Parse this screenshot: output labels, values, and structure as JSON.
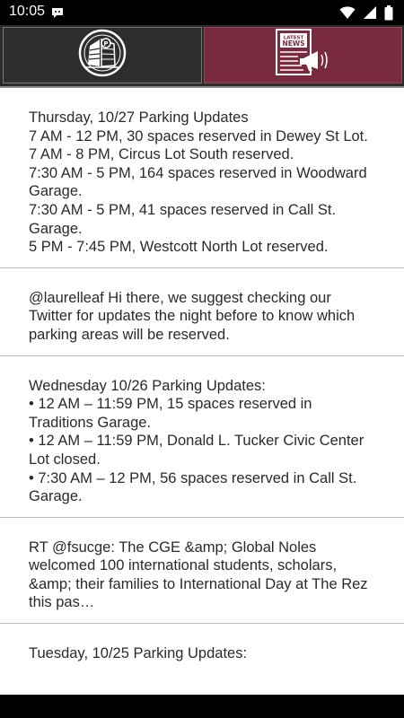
{
  "status_bar": {
    "time": "10:05",
    "icons": [
      "notification-icon",
      "wifi-icon",
      "signal-icon",
      "battery-icon"
    ]
  },
  "tabs": [
    {
      "id": "home",
      "icon": "parking-building-icon",
      "selected": false
    },
    {
      "id": "news",
      "icon": "latest-news-icon",
      "logo_text": "LATEST NEWS",
      "selected": true
    }
  ],
  "colors": {
    "tab_selected": "#7a2a3e",
    "tab_unselected": "#2e2e2e",
    "text": "#2a2a2a",
    "divider": "#bdbdbd"
  },
  "posts": [
    {
      "text": "Thursday, 10/27 Parking Updates\n7 AM - 12 PM, 30 spaces reserved in Dewey St Lot.\n7 AM - 8 PM, Circus Lot South reserved.\n7:30 AM - 5 PM, 164 spaces reserved in Woodward Garage.\n7:30 AM - 5 PM, 41 spaces reserved in Call St. Garage.\n5 PM - 7:45 PM, Westcott North Lot reserved."
    },
    {
      "text": "@laurelleaf Hi there, we suggest checking our Twitter for updates the night before to know which parking areas will be reserved."
    },
    {
      "text": "Wednesday 10/26 Parking Updates:\n• 12 AM – 11:59 PM, 15 spaces reserved in Traditions Garage.\n• 12 AM – 11:59 PM, Donald L. Tucker Civic Center Lot closed.\n• 7:30 AM – 12 PM, 56 spaces reserved in Call St. Garage."
    },
    {
      "text": "RT @fsucge: The CGE &amp; Global Noles welcomed 100 international students, scholars, &amp; their families to International Day at The Rez this pas…"
    },
    {
      "text": "Tuesday, 10/25 Parking Updates:"
    }
  ]
}
